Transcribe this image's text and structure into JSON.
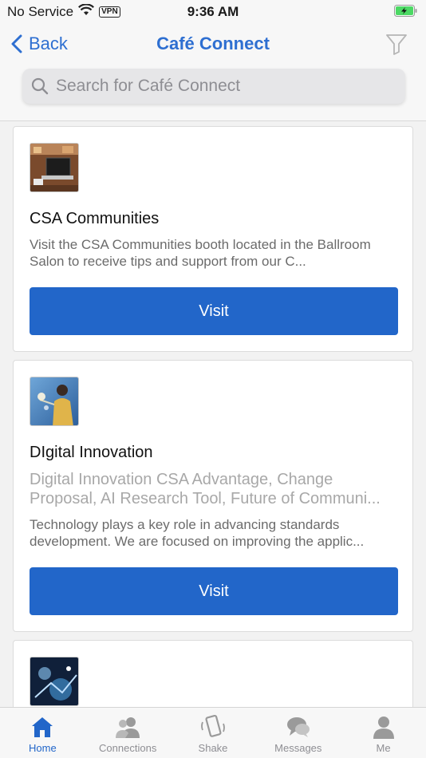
{
  "status_bar": {
    "carrier": "No Service",
    "vpn": "VPN",
    "time": "9:36 AM"
  },
  "nav": {
    "back_label": "Back",
    "title": "Café Connect",
    "filter_icon": "filter-icon"
  },
  "search": {
    "placeholder": "Search for Café Connect"
  },
  "cards": [
    {
      "title": "CSA Communities",
      "description": "Visit the CSA Communities booth located in the Ballroom Salon to receive tips and support from our C...",
      "button_label": "Visit"
    },
    {
      "title": "DIgital Innovation",
      "subtitle": "Digital Innovation CSA Advantage, Change Proposal, AI Research Tool, Future of Communi...",
      "description": "Technology plays a key role in advancing standards development. We are focused on improving the applic...",
      "button_label": "Visit"
    },
    {}
  ],
  "tabs": [
    {
      "label": "Home",
      "icon": "home-icon",
      "active": true
    },
    {
      "label": "Connections",
      "icon": "connections-icon",
      "active": false
    },
    {
      "label": "Shake",
      "icon": "shake-icon",
      "active": false
    },
    {
      "label": "Messages",
      "icon": "messages-icon",
      "active": false
    },
    {
      "label": "Me",
      "icon": "person-icon",
      "active": false
    }
  ],
  "colors": {
    "accent": "#2266c9",
    "nav_title": "#2e6fd1",
    "battery": "#4cd964"
  }
}
